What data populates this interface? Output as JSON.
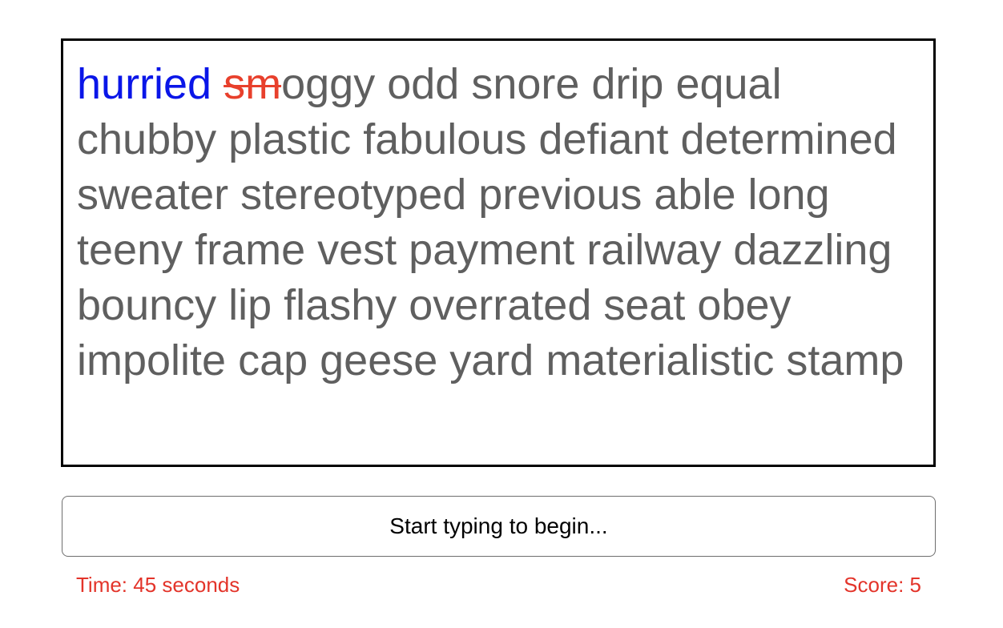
{
  "colors": {
    "correct": "#0a16e8",
    "wrong": "#e8402c",
    "pending": "#5f5f5f",
    "status": "#e3342a"
  },
  "text_display": {
    "correct_word": "hurried",
    "wrong_part": "sm",
    "current_rest": "oggy",
    "remaining": "odd snore drip equal chubby plastic fabulous defiant determined sweater stereotyped previous able long teeny frame vest payment railway dazzling bouncy lip flashy overrated seat obey impolite cap geese yard materialistic stamp"
  },
  "input": {
    "value": "",
    "placeholder": "Start typing to begin..."
  },
  "status": {
    "time": "Time: 45 seconds",
    "score": "Score: 5"
  }
}
